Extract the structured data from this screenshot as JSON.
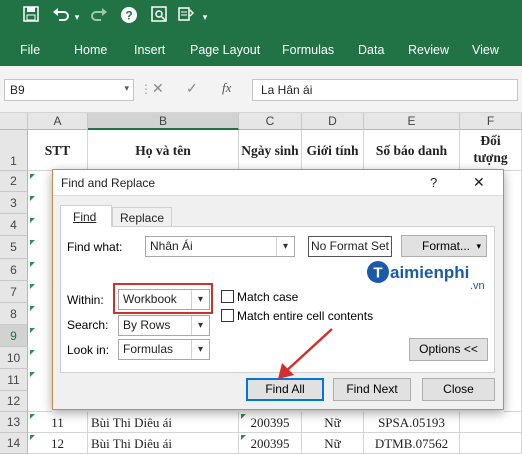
{
  "toolbar": {
    "save_icon": "save-icon",
    "undo_icon": "undo-icon",
    "redo_icon": "redo-icon",
    "help_icon": "help-icon",
    "preview_icon": "print-preview-icon",
    "more_icon": "customize-icon"
  },
  "ribbon": {
    "tabs": [
      "File",
      "Home",
      "Insert",
      "Page Layout",
      "Formulas",
      "Data",
      "Review",
      "View"
    ]
  },
  "formula_bar": {
    "name_box": "B9",
    "formula": "La Hân ái",
    "cancel": "✕",
    "enter": "✓",
    "fx": "fx"
  },
  "columns": [
    "A",
    "B",
    "C",
    "D",
    "E",
    "F"
  ],
  "rows": [
    "1",
    "2",
    "3",
    "4",
    "5",
    "6",
    "7",
    "8",
    "9",
    "10",
    "11",
    "12",
    "13",
    "14"
  ],
  "headers": {
    "stt": "STT",
    "name": "Họ và tên",
    "dob": "Ngày sinh",
    "gender": "Giới tính",
    "sbd": "Số báo danh",
    "group_1": "Đối",
    "group_2": "tượng"
  },
  "data_rows": [
    {
      "stt": "11",
      "name": "Bùi Thi Diêu ái",
      "dob": "200395",
      "gender": "Nữ",
      "sbd": "SPSA.05193"
    },
    {
      "stt": "12",
      "name": "Bùi Thi Diêu ái",
      "dob": "200395",
      "gender": "Nữ",
      "sbd": "DTMB.07562"
    }
  ],
  "dialog": {
    "title": "Find and Replace",
    "help": "?",
    "close": "✕",
    "tabs": {
      "find": "Find",
      "replace": "Replace"
    },
    "find_what_label": "Find what:",
    "find_what_value": "Nhân Ái",
    "no_format": "No Format Set",
    "format_button": "Format...",
    "within_label": "Within:",
    "within_value": "Workbook",
    "search_label": "Search:",
    "search_value": "By Rows",
    "lookin_label": "Look in:",
    "lookin_value": "Formulas",
    "match_case": "Match case",
    "match_entire": "Match entire cell contents",
    "options_button": "Options <<",
    "find_all": "Find All",
    "find_next": "Find Next",
    "close_button": "Close"
  },
  "watermark": {
    "brand": "aimienphi",
    "brand_initial": "T",
    "suffix": ".vn"
  },
  "colors": {
    "excel_green": "#217346",
    "highlight_red": "#d0312d",
    "brand_blue": "#1a5aa8"
  }
}
